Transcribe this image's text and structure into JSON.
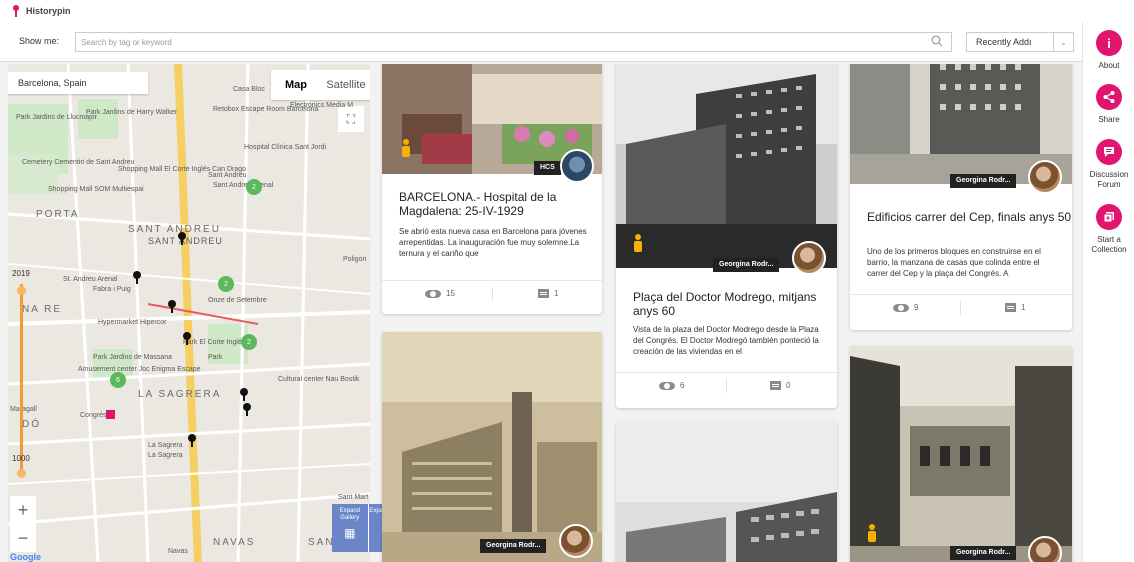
{
  "app": {
    "title": "Historypin"
  },
  "search": {
    "label": "Show me:",
    "placeholder": "Search by tag or keyword",
    "sort_value": "Recently Addı"
  },
  "sidebar": {
    "items": [
      {
        "label": "About",
        "icon": "info-icon"
      },
      {
        "label": "Share",
        "icon": "share-icon"
      },
      {
        "label": "Discussion Forum",
        "icon": "chat-icon"
      },
      {
        "label": "Start a Collection",
        "icon": "add-collection-icon"
      }
    ]
  },
  "map": {
    "location": "Barcelona, Spain",
    "type_map": "Map",
    "type_satellite": "Satellite",
    "timeline_start": "2019",
    "timeline_end": "1000",
    "zoom_in": "+",
    "zoom_out": "−",
    "attribution": "Google",
    "labels": [
      "Casa Bloc",
      "Retobox Escape Room Barcelona",
      "Electronics Media M",
      "Park Jardins de Harry Walker",
      "Park Jardins de Llucmajor",
      "Hospital Clínica Sant Jordi",
      "Cemetery Cementiri de Sant Andreu",
      "Shopping Mall El Corte Inglés Can Drago",
      "Sant Andreu",
      "Sant Andreu Arenal",
      "Shopping Mall SOM Multiespai",
      "PORTA",
      "SANT ANDREU",
      "SANT ANDREU",
      "St. Andreu Arenal",
      "Fabra i Puig",
      "Onze de Setembre",
      "Poligon",
      "Hypermarket Hipercor",
      "Park El Corte Inglés",
      "Park",
      "Amusement center Joc Enigma Escape",
      "Park Jardins de Massana",
      "Cultural center Nau Bostik",
      "LA SAGRERA",
      "Maragall",
      "Congrés",
      "La Sagrera",
      "La Sagrera",
      "DÓ",
      "NA RE",
      "Sant Mart",
      "NAVAS",
      "SANT PROV",
      "Navas"
    ],
    "clusters": [
      "2",
      "2",
      "2",
      "2",
      "6"
    ],
    "expand_gallery": "Expand Gallery",
    "expand_map": "Expand Map"
  },
  "cards": [
    {
      "title": "BARCELONA.- Hospital de la Magdalena: 25-IV-1929",
      "description": "Se abrió esta nueva casa en Barcelona para jóvenes arrepentidas. La inauguración fue muy solemne.La ternura y el cariño que",
      "owner": "HCS",
      "views": "15",
      "comments": "1"
    },
    {
      "title": "Plaça del Doctor Modrego, mitjans anys 60",
      "description": "Vista de la plaza del Doctor Modrego desde la Plaza del Congrés. El Doctor Modregó también ponteció la creación de las viviendas en el",
      "owner": "Georgina Rodr...",
      "views": "6",
      "comments": "0"
    },
    {
      "title": "Edificios carrer del Cep, finals anys 50",
      "description": "Uno de los primeros bloques en construirse en el barrio, la manzana de casas que colinda entre el carrer del Cep y la plaça del Congrés. A",
      "owner": "Georgina Rodr...",
      "views": "9",
      "comments": "1"
    },
    {
      "owner": "Georgina Rodr..."
    },
    {
      "owner": ""
    },
    {
      "owner": "Georgina Rodr..."
    }
  ]
}
